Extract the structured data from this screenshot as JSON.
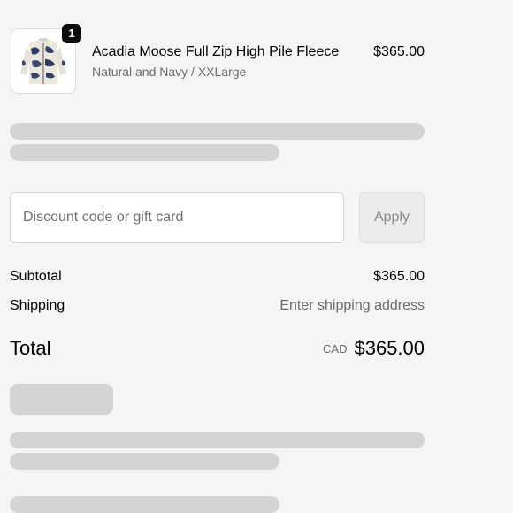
{
  "line_item": {
    "quantity": "1",
    "name": "Acadia Moose Full Zip High Pile Fleece",
    "variant": "Natural and Navy / XXLarge",
    "price": "$365.00",
    "image_icon": "fleece-jacket-image"
  },
  "discount": {
    "placeholder": "Discount code or gift card",
    "value": "",
    "apply_label": "Apply"
  },
  "summary": {
    "subtotal_label": "Subtotal",
    "subtotal_value": "$365.00",
    "shipping_label": "Shipping",
    "shipping_value": "Enter shipping address",
    "total_label": "Total",
    "currency": "CAD",
    "total_value": "$365.00"
  },
  "colors": {
    "background": "#f5f5f5",
    "skeleton": "#d4d4d4",
    "badge": "#0b0b0b",
    "muted_text": "#6b6b6b"
  }
}
